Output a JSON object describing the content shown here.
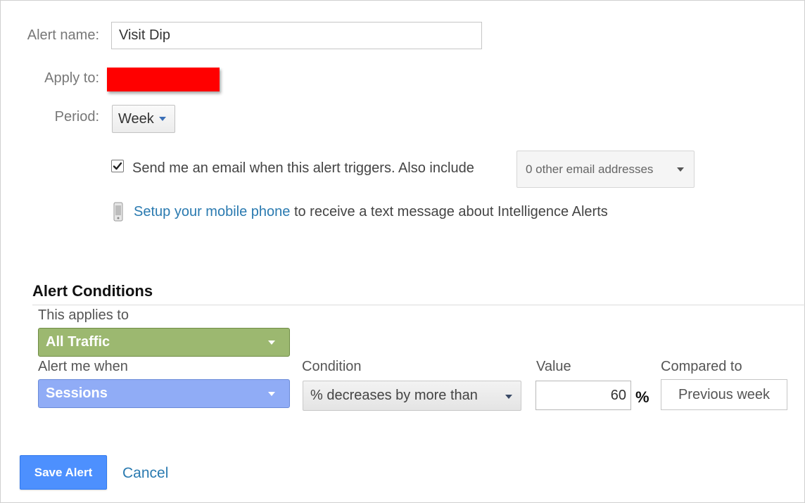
{
  "form": {
    "alert_name_label": "Alert name:",
    "alert_name_value": "Visit Dip",
    "apply_to_label": "Apply to:",
    "period_label": "Period:",
    "period_value": "Week",
    "email_checkbox_checked": true,
    "email_text": "Send me an email when this alert triggers. Also include",
    "email_addresses_value": "0 other email addresses",
    "mobile_link": "Setup your mobile phone",
    "mobile_text": "to receive a text message about Intelligence Alerts"
  },
  "conditions": {
    "title": "Alert Conditions",
    "applies_to_label": "This applies to",
    "applies_to_value": "All Traffic",
    "alert_me_when_label": "Alert me when",
    "alert_me_when_value": "Sessions",
    "condition_label": "Condition",
    "condition_value": "% decreases by more than",
    "value_label": "Value",
    "value_value": "60",
    "value_unit": "%",
    "compared_to_label": "Compared to",
    "compared_to_value": "Previous week"
  },
  "actions": {
    "save_label": "Save Alert",
    "cancel_label": "Cancel"
  },
  "colors": {
    "redaction": "#ff0000",
    "all_traffic_green": "#9cb870",
    "sessions_blue": "#90acf6",
    "save_blue": "#4d90fe",
    "link_blue": "#2a7ab0"
  },
  "icons": {
    "checkbox": "check-icon",
    "mobile": "mobile-phone-icon",
    "dropdown": "caret-down-icon"
  }
}
